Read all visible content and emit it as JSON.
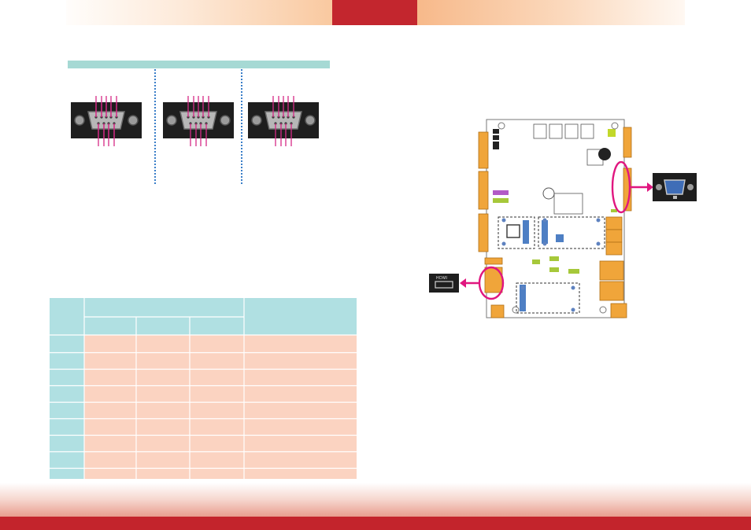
{
  "header": {
    "left_title": "",
    "center_tab": "",
    "right_title": ""
  },
  "colors": {
    "header_red": "#c3262e",
    "teal": "#a6d9d4",
    "table_header": "#b0e0e2",
    "table_row": "#fbd3c1",
    "pink_callout": "#e0167f",
    "board_connector_orange": "#f0a53a"
  },
  "serial_ports": {
    "count": 3,
    "icon": "db9-serial-connector-icon"
  },
  "pin_table": {
    "header_rows": 2,
    "sub_columns": 3,
    "body_rows": 9,
    "cells": []
  },
  "board_diagram": {
    "callout_right_icon": "vga-connector-icon",
    "callout_left_icon": "hdmi-connector-icon",
    "hdmi_label": "HDMI"
  }
}
